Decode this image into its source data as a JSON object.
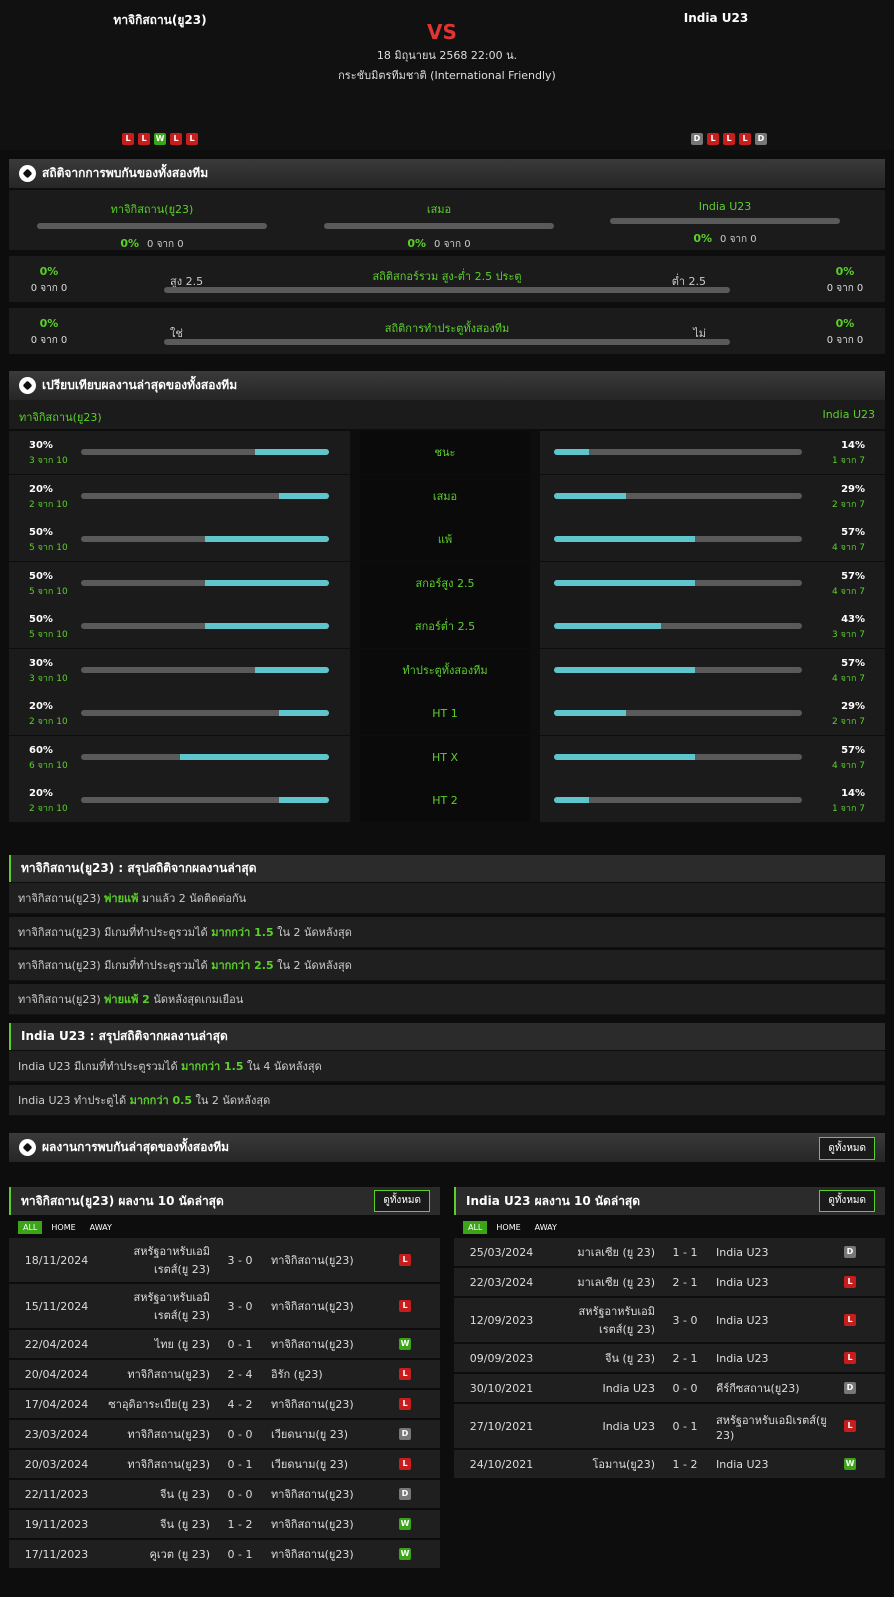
{
  "match": {
    "home": "ทาจิกิสถาน(ยู23)",
    "away": "India U23",
    "vs": "VS",
    "date": "18 มิถุนายน 2568 22:00 น.",
    "competition": "กระชับมิตรทีมชาติ (International Friendly)",
    "home_form": [
      "L",
      "L",
      "W",
      "L",
      "L"
    ],
    "away_form": [
      "D",
      "L",
      "L",
      "L",
      "D"
    ]
  },
  "h2h": {
    "title": "สถิติจากการพบกันของทั้งสองทีม",
    "cols": [
      {
        "name": "ทาจิกิสถาน(ยู23)",
        "pct": "0%",
        "of": "0 จาก 0",
        "value": 0
      },
      {
        "name": "เสมอ",
        "pct": "0%",
        "of": "0 จาก 0",
        "value": 0
      },
      {
        "name": "India U23",
        "pct": "0%",
        "of": "0 จาก 0",
        "value": 0
      }
    ],
    "ou": {
      "title": "สถิติสกอร์รวม สูง-ต่ำ 2.5 ประตู",
      "left_label": "สูง 2.5",
      "right_label": "ต่ำ 2.5",
      "left_pct": "0%",
      "left_of": "0 จาก 0",
      "right_pct": "0%",
      "right_of": "0 จาก 0"
    },
    "btts": {
      "title": "สถิติการทำประตูทั้งสองทีม",
      "left_label": "ใช่",
      "right_label": "ไม่",
      "left_pct": "0%",
      "left_of": "0 จาก 0",
      "right_pct": "0%",
      "right_of": "0 จาก 0"
    }
  },
  "compare": {
    "title": "เปรียบเทียบผลงานล่าสุดของทั้งสองทีม",
    "home": "ทาจิกิสถาน(ยู23)",
    "away": "India U23",
    "rows": [
      {
        "label": "ชนะ",
        "l_pct": "30%",
        "l_of": "3 จาก 10",
        "l": 30,
        "r_pct": "14%",
        "r_of": "1 จาก 7",
        "r": 14
      },
      {
        "label": "เสมอ",
        "l_pct": "20%",
        "l_of": "2 จาก 10",
        "l": 20,
        "r_pct": "29%",
        "r_of": "2 จาก 7",
        "r": 29
      },
      {
        "label": "แพ้",
        "l_pct": "50%",
        "l_of": "5 จาก 10",
        "l": 50,
        "r_pct": "57%",
        "r_of": "4 จาก 7",
        "r": 57
      },
      {
        "label": "สกอร์สูง 2.5",
        "l_pct": "50%",
        "l_of": "5 จาก 10",
        "l": 50,
        "r_pct": "57%",
        "r_of": "4 จาก 7",
        "r": 57
      },
      {
        "label": "สกอร์ต่ำ 2.5",
        "l_pct": "50%",
        "l_of": "5 จาก 10",
        "l": 50,
        "r_pct": "43%",
        "r_of": "3 จาก 7",
        "r": 43
      },
      {
        "label": "ทำประตูทั้งสองทีม",
        "l_pct": "30%",
        "l_of": "3 จาก 10",
        "l": 30,
        "r_pct": "57%",
        "r_of": "4 จาก 7",
        "r": 57
      },
      {
        "label": "HT 1",
        "l_pct": "20%",
        "l_of": "2 จาก 10",
        "l": 20,
        "r_pct": "29%",
        "r_of": "2 จาก 7",
        "r": 29
      },
      {
        "label": "HT X",
        "l_pct": "60%",
        "l_of": "6 จาก 10",
        "l": 60,
        "r_pct": "57%",
        "r_of": "4 จาก 7",
        "r": 57
      },
      {
        "label": "HT 2",
        "l_pct": "20%",
        "l_of": "2 จาก 10",
        "l": 20,
        "r_pct": "14%",
        "r_of": "1 จาก 7",
        "r": 14
      }
    ]
  },
  "home_summary": {
    "title": "ทาจิกิสถาน(ยู23) : สรุปสถิติจากผลงานล่าสุด",
    "rows": [
      [
        "ทาจิกิสถาน(ยู23) ",
        "พ่ายแพ้",
        " มาแล้ว 2 นัดติดต่อกัน"
      ],
      [
        "ทาจิกิสถาน(ยู23) มีเกมที่ทำประตูรวมได้ ",
        "มากกว่า 1.5",
        " ใน 2 นัดหลังสุด"
      ],
      [
        "ทาจิกิสถาน(ยู23) มีเกมที่ทำประตูรวมได้ ",
        "มากกว่า 2.5",
        " ใน 2 นัดหลังสุด"
      ],
      [
        "ทาจิกิสถาน(ยู23) ",
        "พ่ายแพ้ 2",
        " นัดหลังสุดเกมเยือน"
      ]
    ]
  },
  "away_summary": {
    "title": "India U23 : สรุปสถิติจากผลงานล่าสุด",
    "rows": [
      [
        "India U23 มีเกมที่ทำประตูรวมได้ ",
        "มากกว่า 1.5",
        " ใน 4 นัดหลังสุด"
      ],
      [
        "India U23 ทำประตูได้ ",
        "มากกว่า 0.5",
        " ใน 2 นัดหลังสุด"
      ]
    ]
  },
  "recent": {
    "title": "ผลงานการพบกันล่าสุดของทั้งสองทีม",
    "view_all": "ดูทั้งหมด",
    "tabs": [
      "ALL",
      "HOME",
      "AWAY"
    ],
    "home_title": "ทาจิกิสถาน(ยู23) ผลงาน 10 นัดล่าสุด",
    "away_title": "India U23 ผลงาน 10 นัดล่าสุด",
    "home_matches": [
      {
        "date": "18/11/2024",
        "home": "สหรัฐอาหรับเอมิเรตส์(ยู 23)",
        "score": "3 - 0",
        "away": "ทาจิกิสถาน(ยู23)",
        "res": "L",
        "tall": true
      },
      {
        "date": "15/11/2024",
        "home": "สหรัฐอาหรับเอมิเรตส์(ยู 23)",
        "score": "3 - 0",
        "away": "ทาจิกิสถาน(ยู23)",
        "res": "L",
        "tall": true
      },
      {
        "date": "22/04/2024",
        "home": "ไทย (ยู 23)",
        "score": "0 - 1",
        "away": "ทาจิกิสถาน(ยู23)",
        "res": "W"
      },
      {
        "date": "20/04/2024",
        "home": "ทาจิกิสถาน(ยู23)",
        "score": "2 - 4",
        "away": "อิรัก (ยู23)",
        "res": "L"
      },
      {
        "date": "17/04/2024",
        "home": "ซาอุดิอาระเบีย(ยู 23)",
        "score": "4 - 2",
        "away": "ทาจิกิสถาน(ยู23)",
        "res": "L"
      },
      {
        "date": "23/03/2024",
        "home": "ทาจิกิสถาน(ยู23)",
        "score": "0 - 0",
        "away": "เวียดนาม(ยู 23)",
        "res": "D"
      },
      {
        "date": "20/03/2024",
        "home": "ทาจิกิสถาน(ยู23)",
        "score": "0 - 1",
        "away": "เวียดนาม(ยู 23)",
        "res": "L"
      },
      {
        "date": "22/11/2023",
        "home": "จีน (ยู 23)",
        "score": "0 - 0",
        "away": "ทาจิกิสถาน(ยู23)",
        "res": "D"
      },
      {
        "date": "19/11/2023",
        "home": "จีน (ยู 23)",
        "score": "1 - 2",
        "away": "ทาจิกิสถาน(ยู23)",
        "res": "W"
      },
      {
        "date": "17/11/2023",
        "home": "คูเวต (ยู 23)",
        "score": "0 - 1",
        "away": "ทาจิกิสถาน(ยู23)",
        "res": "W"
      }
    ],
    "away_matches": [
      {
        "date": "25/03/2024",
        "home": "มาเลเซีย (ยู 23)",
        "score": "1 - 1",
        "away": "India U23",
        "res": "D"
      },
      {
        "date": "22/03/2024",
        "home": "มาเลเซีย (ยู 23)",
        "score": "2 - 1",
        "away": "India U23",
        "res": "L"
      },
      {
        "date": "12/09/2023",
        "home": "สหรัฐอาหรับเอมิเรตส์(ยู 23)",
        "score": "3 - 0",
        "away": "India U23",
        "res": "L",
        "tall": true
      },
      {
        "date": "09/09/2023",
        "home": "จีน (ยู 23)",
        "score": "2 - 1",
        "away": "India U23",
        "res": "L"
      },
      {
        "date": "30/10/2021",
        "home": "India U23",
        "score": "0 - 0",
        "away": "คีร์กีซสถาน(ยู23)",
        "res": "D"
      },
      {
        "date": "27/10/2021",
        "home": "India U23",
        "score": "0 - 1",
        "away": "สหรัฐอาหรับเอมิเรตส์(ยู 23)",
        "res": "L",
        "tall": true
      },
      {
        "date": "24/10/2021",
        "home": "โอมาน(ยู23)",
        "score": "1 - 2",
        "away": "India U23",
        "res": "W"
      }
    ]
  }
}
